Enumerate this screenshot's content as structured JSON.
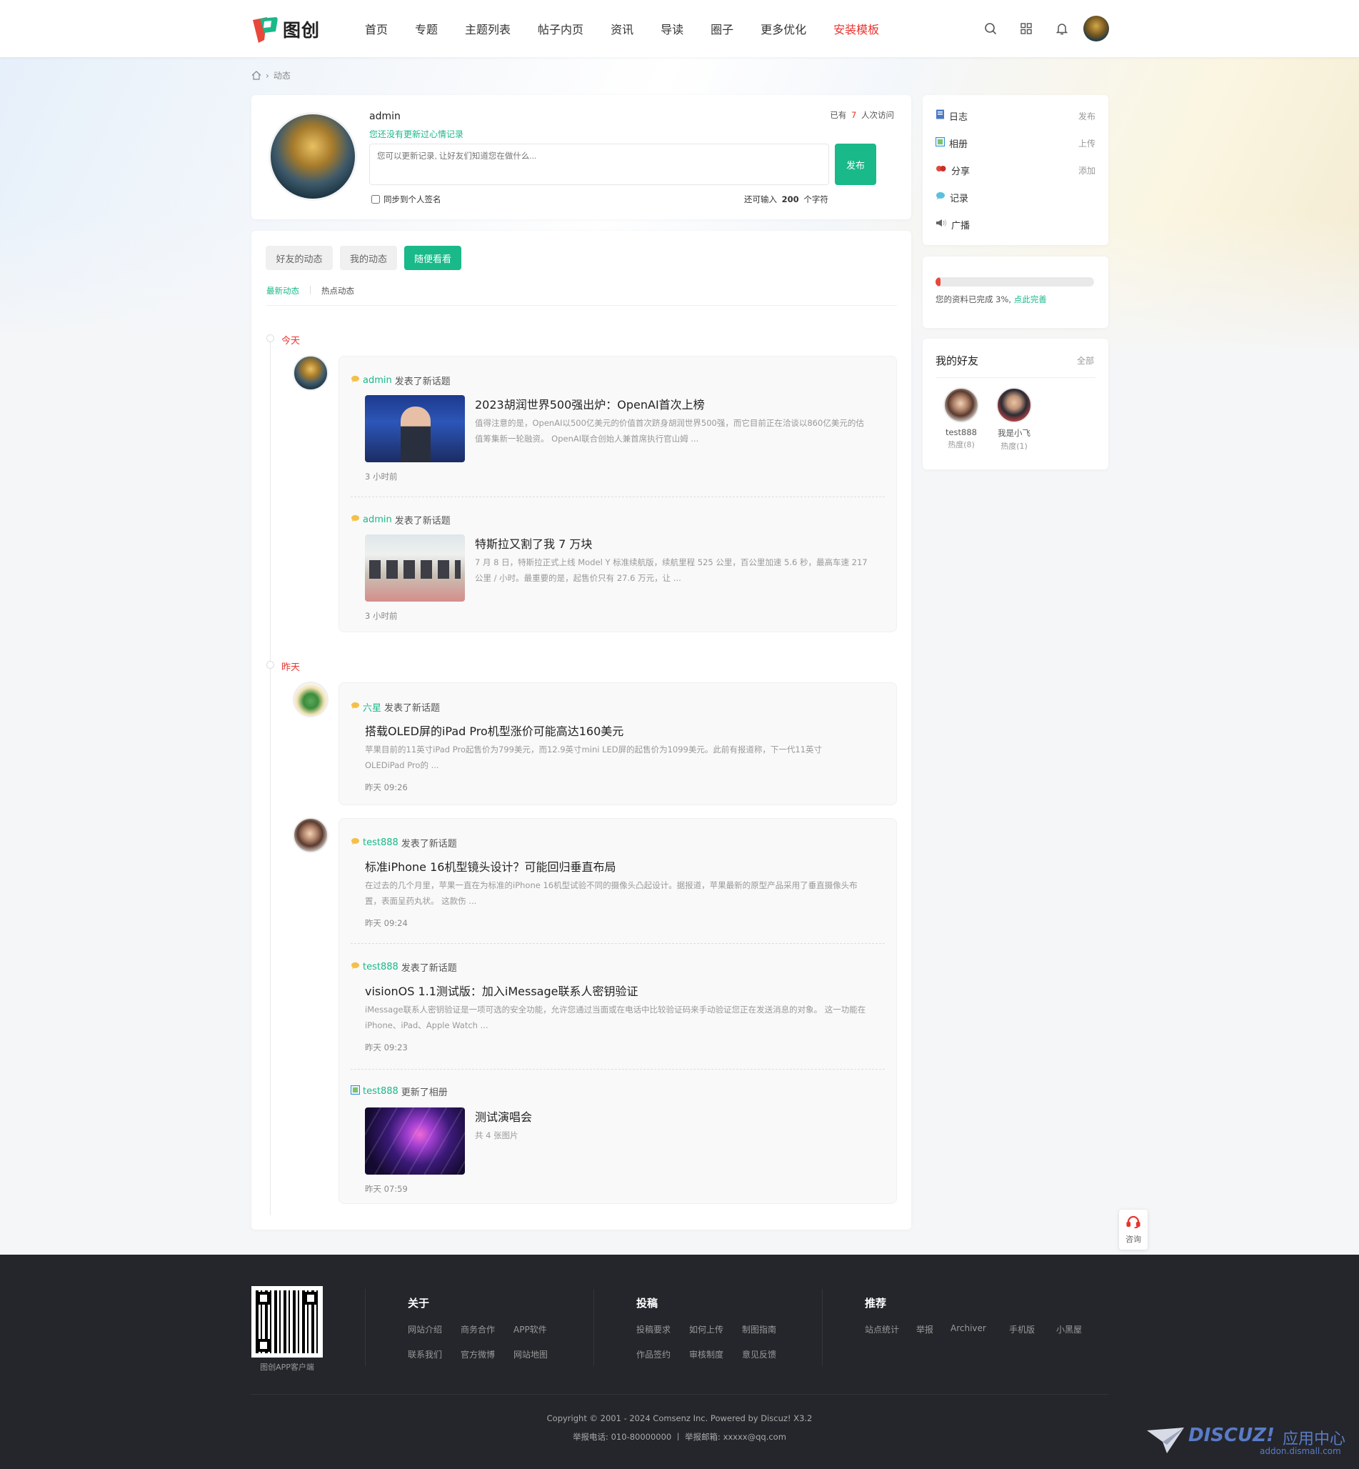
{
  "brand": {
    "name": "图创",
    "colors": {
      "accent": "#19b989",
      "hot": "#e8342f",
      "footer": "#24262b"
    }
  },
  "nav": {
    "items": [
      "首页",
      "专题",
      "主题列表",
      "帖子内页",
      "资讯",
      "导读",
      "圈子",
      "更多优化"
    ],
    "highlight": "安装模板"
  },
  "breadcrumb": {
    "current": "动态"
  },
  "profile": {
    "name": "admin",
    "status": "您还没有更新过心情记录",
    "visits_prefix": "已有",
    "visits_count": "7",
    "visits_suffix": "人次访问",
    "textarea_placeholder": "您可以更新记录, 让好友们知道您在做什么...",
    "publish": "发布",
    "sync_label": "同步到个人签名",
    "remain_prefix": "还可输入",
    "remain_count": "200",
    "remain_suffix": "个字符"
  },
  "tabs": {
    "friends": "好友的动态",
    "mine": "我的动态",
    "random": "随便看看"
  },
  "subtabs": {
    "latest": "最新动态",
    "hot": "热点动态"
  },
  "feed": {
    "today": "今天",
    "yesterday": "昨天",
    "items": [
      {
        "user": "admin",
        "action": "发表了新话题",
        "title": "2023胡润世界500强出炉：OpenAI首次上榜",
        "desc": "值得注意的是，OpenAI以500亿美元的价值首次跻身胡润世界500强，而它目前正在洽谈以860亿美元的估值筹集新一轮融资。 OpenAI联合创始人兼首席执行官山姆 ...",
        "time": "3 小时前"
      },
      {
        "user": "admin",
        "action": "发表了新话题",
        "title": "特斯拉又割了我 7 万块",
        "desc": "7 月 8 日，特斯拉正式上线 Model Y 标准续航版，续航里程 525 公里，百公里加速 5.6 秒，最高车速 217 公里 / 小时。最重要的是，起售价只有 27.6 万元，让 ...",
        "time": "3 小时前"
      },
      {
        "user": "六星",
        "action": "发表了新话题",
        "title": "搭载OLED屏的iPad Pro机型涨价可能高达160美元",
        "desc": "苹果目前的11英寸iPad Pro起售价为799美元，而12.9英寸mini LED屏的起售价为1099美元。此前有报道称，下一代11英寸OLEDiPad Pro的 ...",
        "time": "昨天 09:26"
      },
      {
        "user": "test888",
        "action": "发表了新话题",
        "title": "标准iPhone 16机型镜头设计？可能回归垂直布局",
        "desc": "在过去的几个月里，苹果一直在为标准的iPhone 16机型试验不同的摄像头凸起设计。据报道，苹果最新的原型产品采用了垂直摄像头布置，表面呈药丸状。 这款伤 ...",
        "time": "昨天 09:24"
      },
      {
        "user": "test888",
        "action": "发表了新话题",
        "title": "visionOS 1.1测试版：加入iMessage联系人密钥验证",
        "desc": "iMessage联系人密钥验证是一项可选的安全功能，允许您通过当面或在电话中比较验证码来手动验证您正在发送消息的对象。 这一功能在iPhone、iPad、Apple Watch ...",
        "time": "昨天 09:23"
      },
      {
        "user": "test888",
        "action": "更新了相册",
        "title": "测试演唱会",
        "desc": "共 4 张图片",
        "time": "昨天 07:59"
      }
    ]
  },
  "sidebar": {
    "actions": [
      {
        "label": "日志",
        "action": "发布"
      },
      {
        "label": "相册",
        "action": "上传"
      },
      {
        "label": "分享",
        "action": "添加"
      },
      {
        "label": "记录",
        "action": ""
      },
      {
        "label": "广播",
        "action": ""
      }
    ],
    "progress_percent": 3,
    "progress_text": "您的资料已完成 3%,",
    "progress_link": "点此完善",
    "friends_title": "我的好友",
    "friends_all": "全部",
    "friends": [
      {
        "name": "test888",
        "heat": "热度(8)"
      },
      {
        "name": "我是小飞",
        "heat": "热度(1)"
      }
    ]
  },
  "float": {
    "consult": "咨询"
  },
  "footer": {
    "qr_caption": "图创APP客户端",
    "cols": [
      {
        "title": "关于",
        "links": [
          "网站介绍",
          "商务合作",
          "APP软件",
          "联系我们",
          "官方微博",
          "网站地图"
        ]
      },
      {
        "title": "投稿",
        "links": [
          "投稿要求",
          "如何上传",
          "制图指南",
          "作品签约",
          "审核制度",
          "意见反馈"
        ]
      },
      {
        "title": "推荐",
        "links": [
          "站点统计",
          "举报",
          "Archiver",
          "手机版",
          "小黑屋"
        ]
      }
    ],
    "copyright": "Copyright © 2001 - 2024 Comsenz Inc.  Powered by Discuz! X3.2",
    "contact": "举报电话: 010-80000000 丨 举报邮箱: xxxxx@qq.com",
    "watermark_brand": "DISCUZ!",
    "watermark_cn": "应用中心",
    "watermark_url": "addon.dismall.com"
  }
}
